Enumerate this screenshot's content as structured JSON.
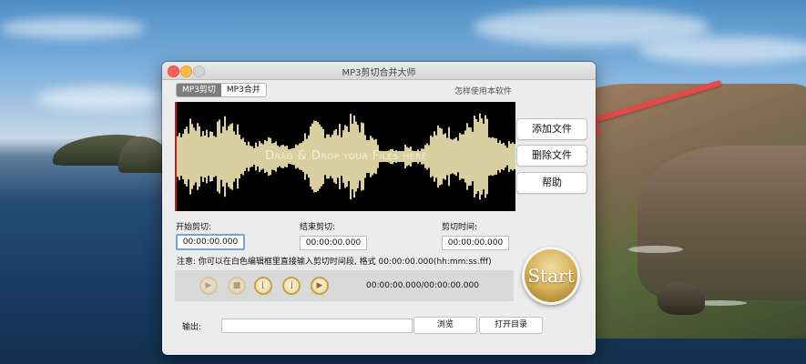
{
  "window": {
    "title": "MP3剪切合并大师",
    "tabs": [
      {
        "label": "MP3剪切",
        "active": true
      },
      {
        "label": "MP3合并",
        "active": false
      }
    ],
    "help_link": "怎样使用本软件"
  },
  "waveform": {
    "drop_text": "Drag & Drop your Files here",
    "wave_color": "#d9cfa0"
  },
  "side_buttons": {
    "add_file": "添加文件",
    "delete_file": "删除文件",
    "help": "帮助"
  },
  "cut": {
    "start_label": "开始剪切:",
    "start_value": "00:00:00.000",
    "end_label": "结束剪切:",
    "end_value": "00:00:00.000",
    "duration_label": "剪切时间:",
    "duration_value": "00:00:00.000",
    "note": "注意: 你可以在白色编辑框里直接输入剪切时间段, 格式 00:00:00.000(hh:mm:ss.fff)"
  },
  "player": {
    "time_display": "00:00:00.000/00:00:00.000",
    "buttons": [
      "play-icon",
      "stop-icon",
      "set-start-icon",
      "set-end-icon",
      "play-selection-icon"
    ]
  },
  "start_button": "Start",
  "output": {
    "label": "输出:",
    "value": "",
    "browse": "浏览",
    "open_dir": "打开目录"
  },
  "colors": {
    "annotation_arrow": "#e34a4a",
    "start_gold": "#d8b35b"
  }
}
